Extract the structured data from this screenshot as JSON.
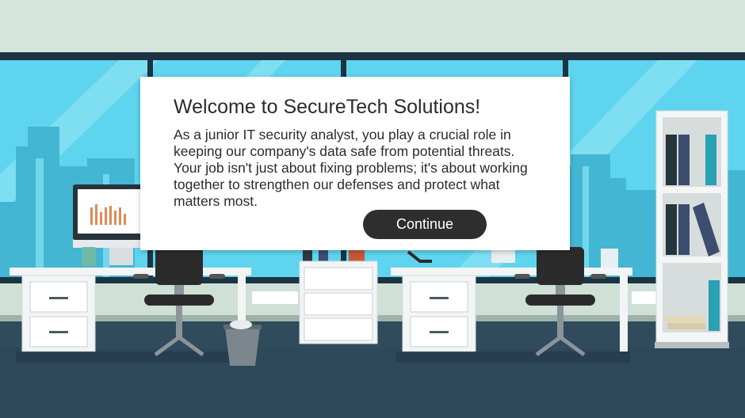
{
  "dialog": {
    "title": "Welcome to SecureTech Solutions!",
    "body": "As a junior IT security analyst, you play a crucial role in keeping our company's data safe from potential threats. Your job isn't just about fixing problems; it's about working together to strengthen our defenses and protect what matters most.",
    "continue_label": "Continue"
  },
  "scene": {
    "colors": {
      "wall": "#d6e5dd",
      "window_frame": "#1c3442",
      "sky": "#5fd4ee",
      "floor": "#2f4b5c",
      "desk": "#f2f5f5",
      "chair": "#2b2b2b",
      "binder_teal": "#2aa0b3",
      "binder_navy": "#3c4d6d"
    }
  }
}
